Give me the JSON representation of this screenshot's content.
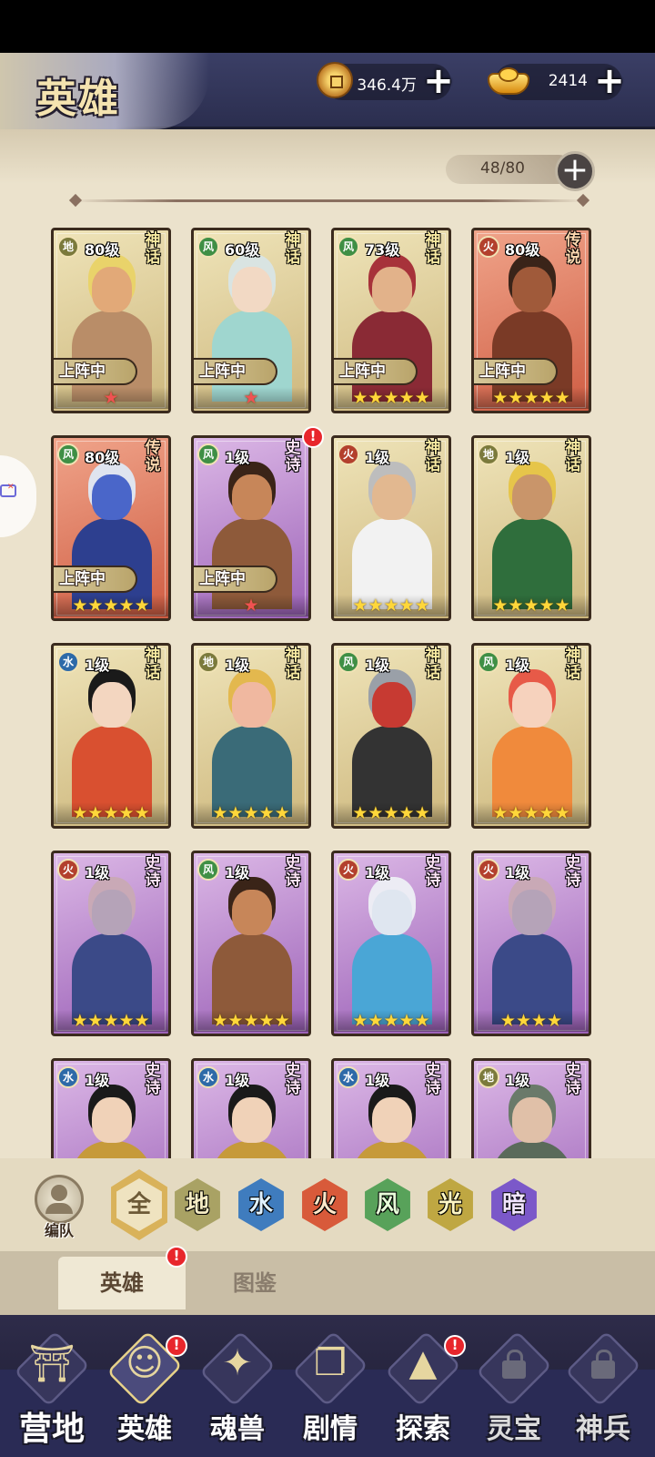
{
  "header": {
    "title": "英雄",
    "coins": "346.4万",
    "ingots": "2414",
    "plus_icon": "plus-icon"
  },
  "roster": {
    "count": "48/80"
  },
  "cards": [
    {
      "element": "地",
      "level": "80级",
      "rarity": "神话",
      "deployed": "上阵中",
      "stars": 1,
      "star_color": "red",
      "rarity_class": "r-myth",
      "hair": "#e9d36a",
      "skin": "#e2a978",
      "outfit": "#b98d68"
    },
    {
      "element": "风",
      "level": "60级",
      "rarity": "神话",
      "deployed": "上阵中",
      "stars": 1,
      "star_color": "red",
      "rarity_class": "r-myth",
      "hair": "#d9e4e2",
      "skin": "#f2d9c4",
      "outfit": "#9fd6cf"
    },
    {
      "element": "风",
      "level": "73级",
      "rarity": "神话",
      "deployed": "上阵中",
      "stars": 5,
      "star_color": "gold",
      "rarity_class": "r-myth",
      "hair": "#a7323a",
      "skin": "#e2b28a",
      "outfit": "#8a2a35"
    },
    {
      "element": "火",
      "level": "80级",
      "rarity": "传说",
      "deployed": "上阵中",
      "stars": 5,
      "star_color": "gold",
      "rarity_class": "r-legend",
      "hair": "#3a2419",
      "skin": "#a05a3a",
      "outfit": "#7a3a26"
    },
    {
      "element": "风",
      "level": "80级",
      "rarity": "传说",
      "deployed": "上阵中",
      "stars": 5,
      "star_color": "gold",
      "rarity_class": "r-legend",
      "hair": "#dfe4ef",
      "skin": "#4a66c9",
      "outfit": "#2d3f8f"
    },
    {
      "element": "风",
      "level": "1级",
      "rarity": "史诗",
      "deployed": "上阵中",
      "stars": 1,
      "star_color": "red",
      "rarity_class": "r-epic",
      "hair": "#3a2418",
      "skin": "#c78659",
      "outfit": "#8e5a3a",
      "notif": "!"
    },
    {
      "element": "火",
      "level": "1级",
      "rarity": "神话",
      "deployed": "",
      "stars": 5,
      "star_color": "gold",
      "rarity_class": "r-myth",
      "hair": "#bdbdbd",
      "skin": "#e2b890",
      "outfit": "#f2f2f2"
    },
    {
      "element": "地",
      "level": "1级",
      "rarity": "神话",
      "deployed": "",
      "stars": 5,
      "star_color": "gold",
      "rarity_class": "r-myth",
      "hair": "#e6c54a",
      "skin": "#c9956a",
      "outfit": "#2f6e3c"
    },
    {
      "element": "水",
      "level": "1级",
      "rarity": "神话",
      "deployed": "",
      "stars": 5,
      "star_color": "gold",
      "rarity_class": "r-myth",
      "hair": "#1a1a1a",
      "skin": "#f3d6c0",
      "outfit": "#d95030"
    },
    {
      "element": "地",
      "level": "1级",
      "rarity": "神话",
      "deployed": "",
      "stars": 5,
      "star_color": "gold",
      "rarity_class": "r-myth",
      "hair": "#e3b84e",
      "skin": "#f0b8a0",
      "outfit": "#3a6b78"
    },
    {
      "element": "风",
      "level": "1级",
      "rarity": "神话",
      "deployed": "",
      "stars": 5,
      "star_color": "gold",
      "rarity_class": "r-myth",
      "hair": "#9aa0a8",
      "skin": "#c73a32",
      "outfit": "#333333"
    },
    {
      "element": "风",
      "level": "1级",
      "rarity": "神话",
      "deployed": "",
      "stars": 5,
      "star_color": "gold",
      "rarity_class": "r-myth",
      "hair": "#e75a48",
      "skin": "#f6d2bd",
      "outfit": "#f08a3c"
    },
    {
      "element": "火",
      "level": "1级",
      "rarity": "史诗",
      "deployed": "",
      "stars": 5,
      "star_color": "gold",
      "rarity_class": "r-epic",
      "hair": "#c9a9b6",
      "skin": "#b5a3b8",
      "outfit": "#3b4a88"
    },
    {
      "element": "风",
      "level": "1级",
      "rarity": "史诗",
      "deployed": "",
      "stars": 5,
      "star_color": "gold",
      "rarity_class": "r-epic",
      "hair": "#3a2418",
      "skin": "#c78659",
      "outfit": "#8e5a3a"
    },
    {
      "element": "火",
      "level": "1级",
      "rarity": "史诗",
      "deployed": "",
      "stars": 5,
      "star_color": "gold",
      "rarity_class": "r-epic",
      "hair": "#ececf4",
      "skin": "#dfe6f0",
      "outfit": "#4aa6d6"
    },
    {
      "element": "火",
      "level": "1级",
      "rarity": "史诗",
      "deployed": "",
      "stars": 4,
      "star_color": "gold",
      "rarity_class": "r-epic",
      "hair": "#c9a9b6",
      "skin": "#b5a3b8",
      "outfit": "#3b4a88"
    },
    {
      "element": "水",
      "level": "1级",
      "rarity": "史诗",
      "deployed": "",
      "stars": 0,
      "star_color": "gold",
      "rarity_class": "r-epic",
      "hair": "#1a1a1a",
      "skin": "#f0d2b8",
      "outfit": "#c69a3a"
    },
    {
      "element": "水",
      "level": "1级",
      "rarity": "史诗",
      "deployed": "",
      "stars": 0,
      "star_color": "gold",
      "rarity_class": "r-epic",
      "hair": "#1a1a1a",
      "skin": "#f0d2b8",
      "outfit": "#c69a3a"
    },
    {
      "element": "水",
      "level": "1级",
      "rarity": "史诗",
      "deployed": "",
      "stars": 0,
      "star_color": "gold",
      "rarity_class": "r-epic",
      "hair": "#1a1a1a",
      "skin": "#f0d2b8",
      "outfit": "#c69a3a"
    },
    {
      "element": "地",
      "level": "1级",
      "rarity": "史诗",
      "deployed": "",
      "stars": 0,
      "star_color": "gold",
      "rarity_class": "r-epic",
      "hair": "#6a7a6a",
      "skin": "#e0c0a8",
      "outfit": "#5a6a5a"
    }
  ],
  "filters": {
    "squad_label": "编队",
    "all": "全",
    "earth": "地",
    "water": "水",
    "fire": "火",
    "wind": "风",
    "light": "光",
    "dark": "暗"
  },
  "tabs": {
    "heroes": "英雄",
    "codex": "图鉴",
    "heroes_badge": "!"
  },
  "nav": {
    "camp": "营地",
    "heroes": "英雄",
    "beasts": "魂兽",
    "story": "剧情",
    "explore": "探索",
    "treasure": "灵宝",
    "weapons": "神兵",
    "badge": "!"
  },
  "colors": {
    "header_bg": "#2b2e4f",
    "paper": "#ebe2cc",
    "badge_red": "#e8262c",
    "star_gold": "#ffd73a"
  }
}
